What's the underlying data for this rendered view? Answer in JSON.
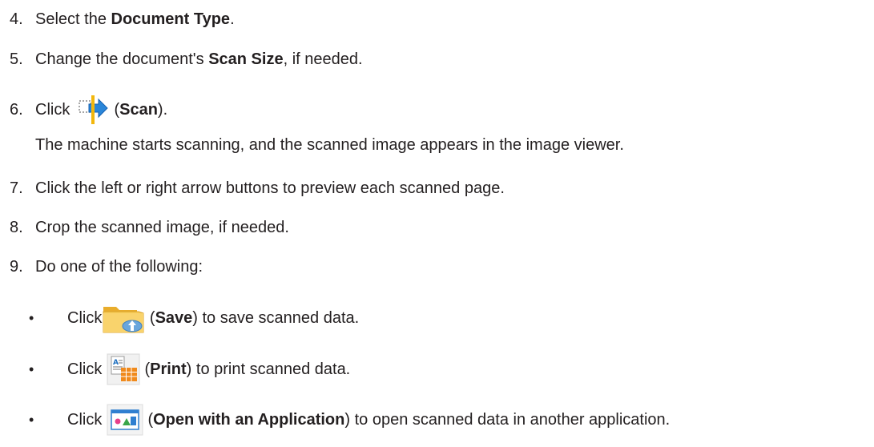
{
  "steps": [
    {
      "num": "4.",
      "pre": "Select the ",
      "bold": "Document Type",
      "post": "."
    },
    {
      "num": "5.",
      "pre": "Change the document's ",
      "bold": "Scan Size",
      "post": ", if needed."
    },
    {
      "num": "6.",
      "pre": "Click ",
      "open": " (",
      "bold": "Scan",
      "post": ")."
    },
    {
      "num": "7.",
      "text": "Click the left or right arrow buttons to preview each scanned page."
    },
    {
      "num": "8.",
      "text": "Crop the scanned image, if needed."
    },
    {
      "num": "9.",
      "text": "Do one of the following:"
    }
  ],
  "step6_detail": "The machine starts scanning, and the scanned image appears in the image viewer.",
  "options": [
    {
      "bullet": "•",
      "pre": "Click",
      "open": " (",
      "bold": "Save",
      "post": ") to save scanned data.",
      "icon": "save-folder-icon"
    },
    {
      "bullet": "•",
      "pre": "Click ",
      "open": " (",
      "bold": "Print",
      "post": ") to print scanned data.",
      "icon": "print-icon"
    },
    {
      "bullet": "•",
      "pre": "Click ",
      "open": " (",
      "bold": "Open with an Application",
      "post": ") to open scanned data in another application.",
      "icon": "open-with-application-icon"
    }
  ],
  "colors": {
    "text": "#231f20",
    "scan_arrow": "#1e7fd6",
    "scan_bar": "#f2b70d",
    "folder": "#f5c64a"
  }
}
